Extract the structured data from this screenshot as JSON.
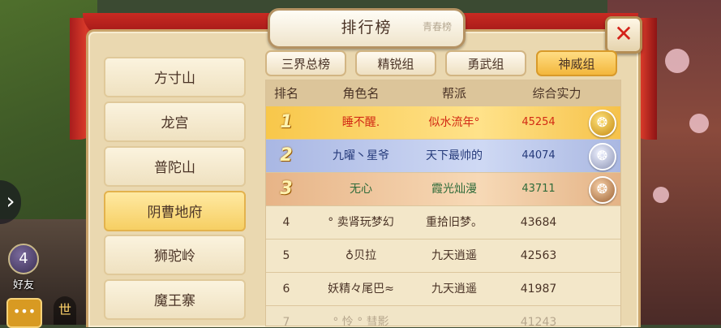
{
  "title": "排行榜",
  "title_stamp": "青春榜",
  "close_icon": "✕",
  "side_arrow_icon": "›",
  "friend": {
    "label": "好友",
    "badge": "4"
  },
  "voice_label": "世",
  "categories": [
    {
      "label": "方寸山",
      "active": false
    },
    {
      "label": "龙宫",
      "active": false
    },
    {
      "label": "普陀山",
      "active": false
    },
    {
      "label": "阴曹地府",
      "active": true
    },
    {
      "label": "狮驼岭",
      "active": false
    },
    {
      "label": "魔王寨",
      "active": false
    }
  ],
  "tabs": [
    {
      "label": "三界总榜",
      "active": false
    },
    {
      "label": "精锐组",
      "active": false
    },
    {
      "label": "勇武组",
      "active": false
    },
    {
      "label": "神威组",
      "active": true
    }
  ],
  "columns": [
    "排名",
    "角色名",
    "帮派",
    "综合实力"
  ],
  "rows": [
    {
      "rank": "1",
      "name": "睡不醒.",
      "guild": "似水流年°",
      "power": "45254",
      "medal": "gold"
    },
    {
      "rank": "2",
      "name": "九曜丶星爷",
      "guild": "天下最帅的",
      "power": "44074",
      "medal": "silver"
    },
    {
      "rank": "3",
      "name": "无心",
      "guild": "霞光灿漫",
      "power": "43711",
      "medal": "bronze"
    },
    {
      "rank": "4",
      "name": "° 卖肾玩梦幻",
      "guild": "重拾旧梦。",
      "power": "43684"
    },
    {
      "rank": "5",
      "name": "♁贝拉",
      "guild": "九天逍遥",
      "power": "42563"
    },
    {
      "rank": "6",
      "name": "妖精々尾巴≈",
      "guild": "九天逍遥",
      "power": "41987"
    },
    {
      "rank": "7",
      "name": "° 怜 ° 彗影",
      "guild": "",
      "power": "41243"
    }
  ],
  "colors": {
    "gold_row": "#f8c74a",
    "silver_row": "#a9b7e3",
    "bronze_row": "#e7b487",
    "active_tab": "#f3b73c"
  }
}
